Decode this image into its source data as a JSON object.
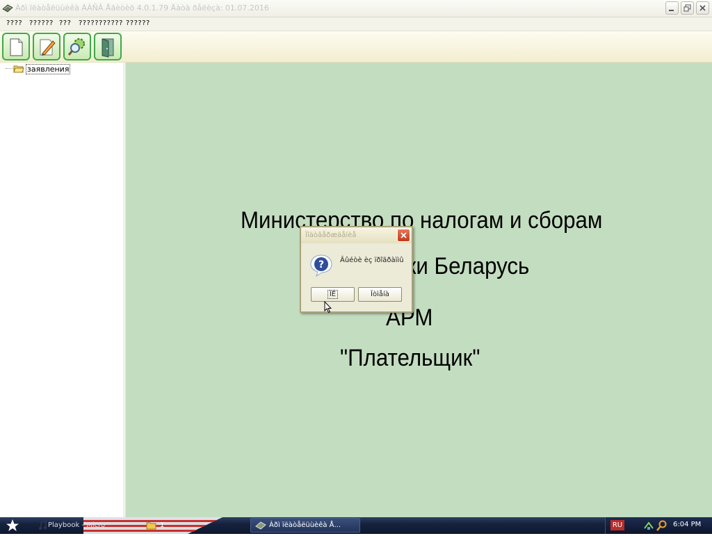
{
  "window": {
    "title": "Àðì ïëàòåëüùèêà ÀÀÑÂ Åäèòèõ 4.0.1.79 Äàòà ðåëèçà: 01.07.2016"
  },
  "menu": {
    "items": [
      "????",
      "??????",
      "???",
      "???????????",
      "??????"
    ]
  },
  "toolbar": {
    "buttons": [
      "new-document-icon",
      "edit-pencil-icon",
      "search-settings-icon",
      "exit-door-icon"
    ]
  },
  "tree": {
    "root_label": "заявления"
  },
  "banner": {
    "line1": "Министерство по налогам и сборам",
    "line2": "Республики Беларусь",
    "line3": "АРМ",
    "line4": "\"Плательщик\""
  },
  "dialog": {
    "title": "Ïîäòâåðæäåíèå",
    "message": "Âûéòè èç ïðîãðàììû",
    "ok_label": "ÎÊ",
    "cancel_label": "Îòìåíà"
  },
  "taskbar": {
    "tasks": [
      {
        "label": "Playbook - Micro"
      },
      {
        "label": "1"
      },
      {
        "label": "Àðì ïëàòåëüùèêà Å..."
      }
    ],
    "language": "RU",
    "clock": "6:04 PM"
  },
  "colors": {
    "main_background": "#c3ddc0",
    "toolbar_button_border": "#3fa84a",
    "dialog_close": "#c0391c"
  }
}
